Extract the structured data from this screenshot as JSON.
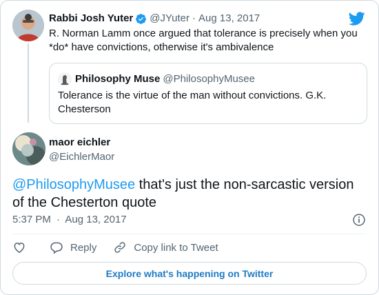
{
  "parent_tweet": {
    "author_name": "Rabbi Josh Yuter",
    "handle": "@JYuter",
    "separator": "·",
    "date": "Aug 13, 2017",
    "text": "R. Norman Lamm once argued that tolerance is precisely when you *do* have convictions, otherwise it's ambivalence",
    "quoted": {
      "author_name": "Philosophy Muse",
      "handle": "@PhilosophyMusee",
      "text": "Tolerance is the virtue of the man without convictions. G.K. Chesterson"
    }
  },
  "main_tweet": {
    "author_name": "maor eichler",
    "handle": "@EichlerMaor",
    "mention": "@PhilosophyMusee",
    "text": " that's just the non-sarcastic version of the Chesterton quote",
    "time": "5:37 PM",
    "separator": "·",
    "date": "Aug 13, 2017"
  },
  "actions": {
    "like_label": "",
    "reply_label": "Reply",
    "copy_label": "Copy link to Tweet"
  },
  "explore_label": "Explore what's happening on Twitter",
  "icons": [
    "verified-badge-icon",
    "twitter-bird-icon",
    "info-icon",
    "heart-icon",
    "reply-icon",
    "link-icon"
  ],
  "colors": {
    "accent": "#1d9bf0",
    "text": "#0f1419",
    "muted": "#536471",
    "border": "#cfd9de"
  }
}
